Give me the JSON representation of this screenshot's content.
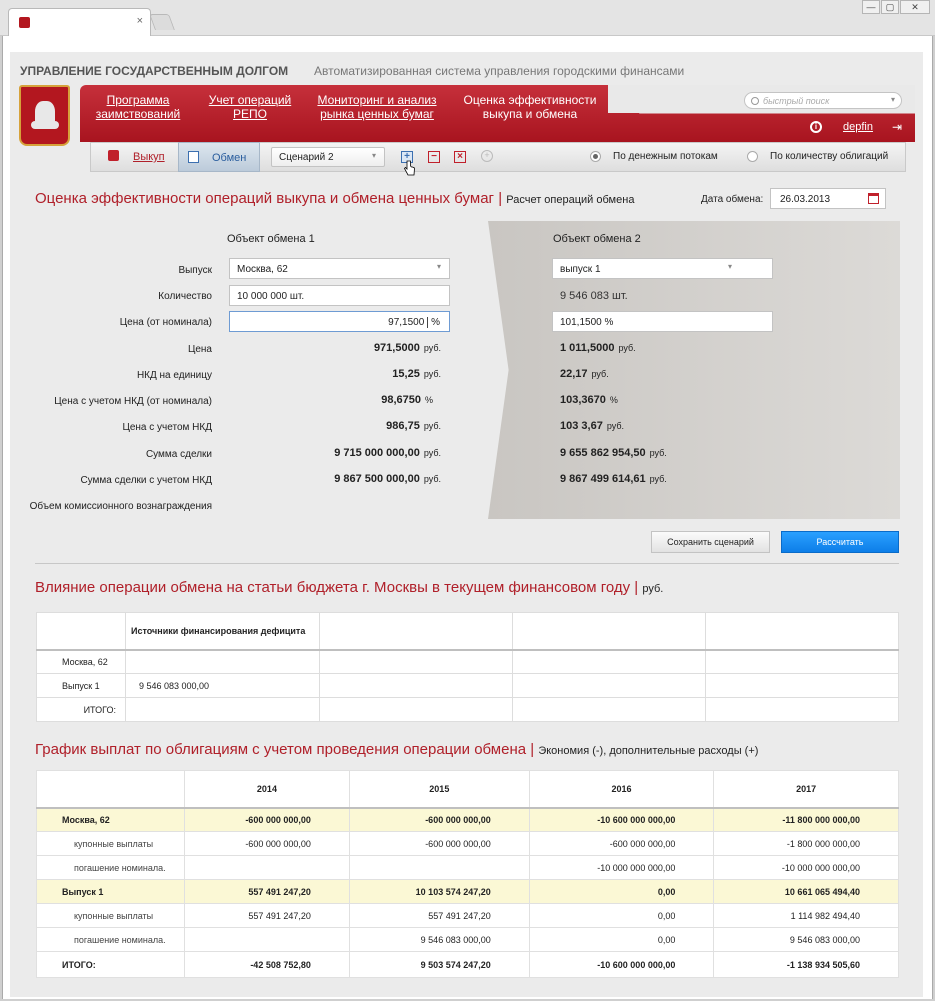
{
  "browser": {
    "close_tab": "×",
    "win_min": "—",
    "win_max": "▢",
    "win_close": "✕"
  },
  "header": {
    "brand": "УПРАВЛЕНИЕ ГОСУДАРСТВЕННЫМ ДОЛГОМ",
    "subtitle": "Автоматизированная система управления городскими финансами"
  },
  "nav": {
    "items": [
      {
        "line1": "Программа",
        "line2": "заимствований"
      },
      {
        "line1": "Учет операций",
        "line2": "РЕПО"
      },
      {
        "line1": "Мониторинг и анализ",
        "line2": "рынка ценных бумаг"
      }
    ],
    "active": {
      "line1": "Оценка эффективности",
      "line2": "выкупа и обмена"
    },
    "search_placeholder": "быстрый поиск",
    "user": "depfin",
    "info_icon": "i"
  },
  "toolbar": {
    "vykup": "Выкуп",
    "obmen": "Обмен",
    "scenario": "Сценарий 2",
    "add_icon": "+",
    "remove_icon": "−",
    "delete_icon": "×",
    "zoom_icon": "+",
    "radio1": "По денежным потокам",
    "radio2": "По количеству облигаций"
  },
  "section1": {
    "title": "Оценка эффективности операций выкупа и обмена ценных бумаг",
    "sep": "|",
    "subtitle": "Расчет операций обмена",
    "date_label": "Дата обмена:",
    "date_value": "26.03.2013",
    "obj1_title": "Объект обмена 1",
    "obj2_title": "Объект обмена 2",
    "labels": {
      "vypusk": "Выпуск",
      "qty": "Количество",
      "price_nom": "Цена (от номинала)",
      "price": "Цена",
      "nkd": "НКД на единицу",
      "price_nkd_nom": "Цена с учетом НКД (от номинала)",
      "price_nkd": "Цена с учетом НКД",
      "sum": "Сумма сделки",
      "sum_nkd": "Сумма сделки с учетом НКД",
      "commission": "Объем комиссионного вознаграждения"
    },
    "obj1": {
      "vypusk": "Москва, 62",
      "qty": "10 000 000 шт.",
      "price_nom": "97,1500",
      "price_nom_unit": "%",
      "price": "971,5000",
      "nkd": "15,25",
      "price_nkd_nom": "98,6750",
      "price_nkd": "986,75",
      "sum": "9 715 000 000,00",
      "sum_nkd": "9 867 500 000,00"
    },
    "obj2": {
      "vypusk": "выпуск 1",
      "qty": "9 546 083 шт.",
      "price_nom": "101,1500 %",
      "price": "1 011,5000",
      "nkd": "22,17",
      "price_nkd_nom": "103,3670",
      "price_nkd": "103 3,67",
      "sum": "9 655 862 954,50",
      "sum_nkd": "9 867 499 614,61"
    },
    "units": {
      "rub": "руб.",
      "pct": "%"
    },
    "save_button": "Сохранить сценарий",
    "calc_button": "Рассчитать"
  },
  "section2": {
    "title": "Влияние операции обмена на статьи бюджета г. Москвы в текущем финансовом году",
    "sep": "|",
    "subtitle": "руб.",
    "col1": "Источники финансирования дефицита",
    "rows": [
      {
        "label": "Москва, 62",
        "value": ""
      },
      {
        "label": "Выпуск 1",
        "value": "9 546 083 000,00"
      },
      {
        "label": "ИТОГО:",
        "value": ""
      }
    ]
  },
  "section3": {
    "title": "График выплат по облигациям с учетом проведения операции обмена",
    "sep": "|",
    "subtitle": "Экономия (-), дополнительные расходы (+)",
    "years": [
      "2014",
      "2015",
      "2016",
      "2017"
    ],
    "rows": [
      {
        "type": "grp",
        "label": "Москва, 62",
        "values": [
          "-600 000 000,00",
          "-600 000 000,00",
          "-10 600 000 000,00",
          "-11 800 000 000,00"
        ]
      },
      {
        "type": "sub",
        "label": "купонные выплаты",
        "values": [
          "-600 000 000,00",
          "-600 000 000,00",
          "-600 000 000,00",
          "-1 800 000 000,00"
        ]
      },
      {
        "type": "sub",
        "label": "погашение номинала.",
        "values": [
          "",
          "",
          "-10 000 000 000,00",
          "-10 000 000 000,00"
        ]
      },
      {
        "type": "grp",
        "label": "Выпуск 1",
        "values": [
          "557 491 247,20",
          "10 103 574 247,20",
          "0,00",
          "10 661 065 494,40"
        ]
      },
      {
        "type": "sub",
        "label": "купонные выплаты",
        "values": [
          "557 491 247,20",
          "557 491 247,20",
          "0,00",
          "1 114 982 494,40"
        ]
      },
      {
        "type": "sub",
        "label": "погашение номинала.",
        "values": [
          "",
          "9 546 083 000,00",
          "0,00",
          "9 546 083 000,00"
        ]
      },
      {
        "type": "total",
        "label": "ИТОГО:",
        "values": [
          "-42 508 752,80",
          "9 503 574 247,20",
          "-10 600 000 000,00",
          "-1 138 934 505,60"
        ]
      }
    ]
  }
}
